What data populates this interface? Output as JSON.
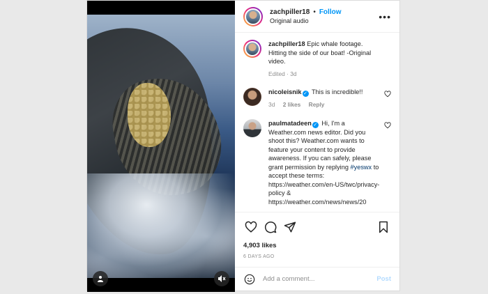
{
  "header": {
    "username": "zachpiller18",
    "separator": "•",
    "follow_label": "Follow",
    "subtitle": "Original audio",
    "more_icon": "more-horizontal-icon"
  },
  "caption": {
    "username": "zachpiller18",
    "text": "Epic whale footage. Hitting the side of our boat! -Original video.",
    "meta": "Edited · 3d"
  },
  "comments": [
    {
      "username": "nicoleisnik",
      "verified": true,
      "text": "This is incredible!!",
      "time": "3d",
      "likes": "2 likes",
      "reply_label": "Reply"
    },
    {
      "username": "paulmatadeen",
      "verified": true,
      "text_before": "Hi, I'm a Weather.com news editor. Did you shoot this? Weather.com wants to feature your content to provide awareness. If you can safely, please grant permission by replying ",
      "hashtag": "#yeswx",
      "text_after": " to accept these terms: https://weather.com/en-US/twc/privacy-policy & https://weather.com/news/news/20"
    }
  ],
  "actions": {
    "like_icon": "heart-icon",
    "comment_icon": "comment-icon",
    "share_icon": "share-icon",
    "save_icon": "bookmark-icon"
  },
  "likes": "4,903 likes",
  "posted_ago": "6 DAYS AGO",
  "add_comment": {
    "placeholder": "Add a comment...",
    "post_label": "Post",
    "emoji_icon": "emoji-icon"
  },
  "media": {
    "user_button_icon": "user-tag-icon",
    "mute_button_icon": "muted-speaker-icon"
  },
  "colors": {
    "link_blue": "#0095f6",
    "post_disabled": "#b3dbff",
    "muted_text": "#8e8e8e"
  }
}
